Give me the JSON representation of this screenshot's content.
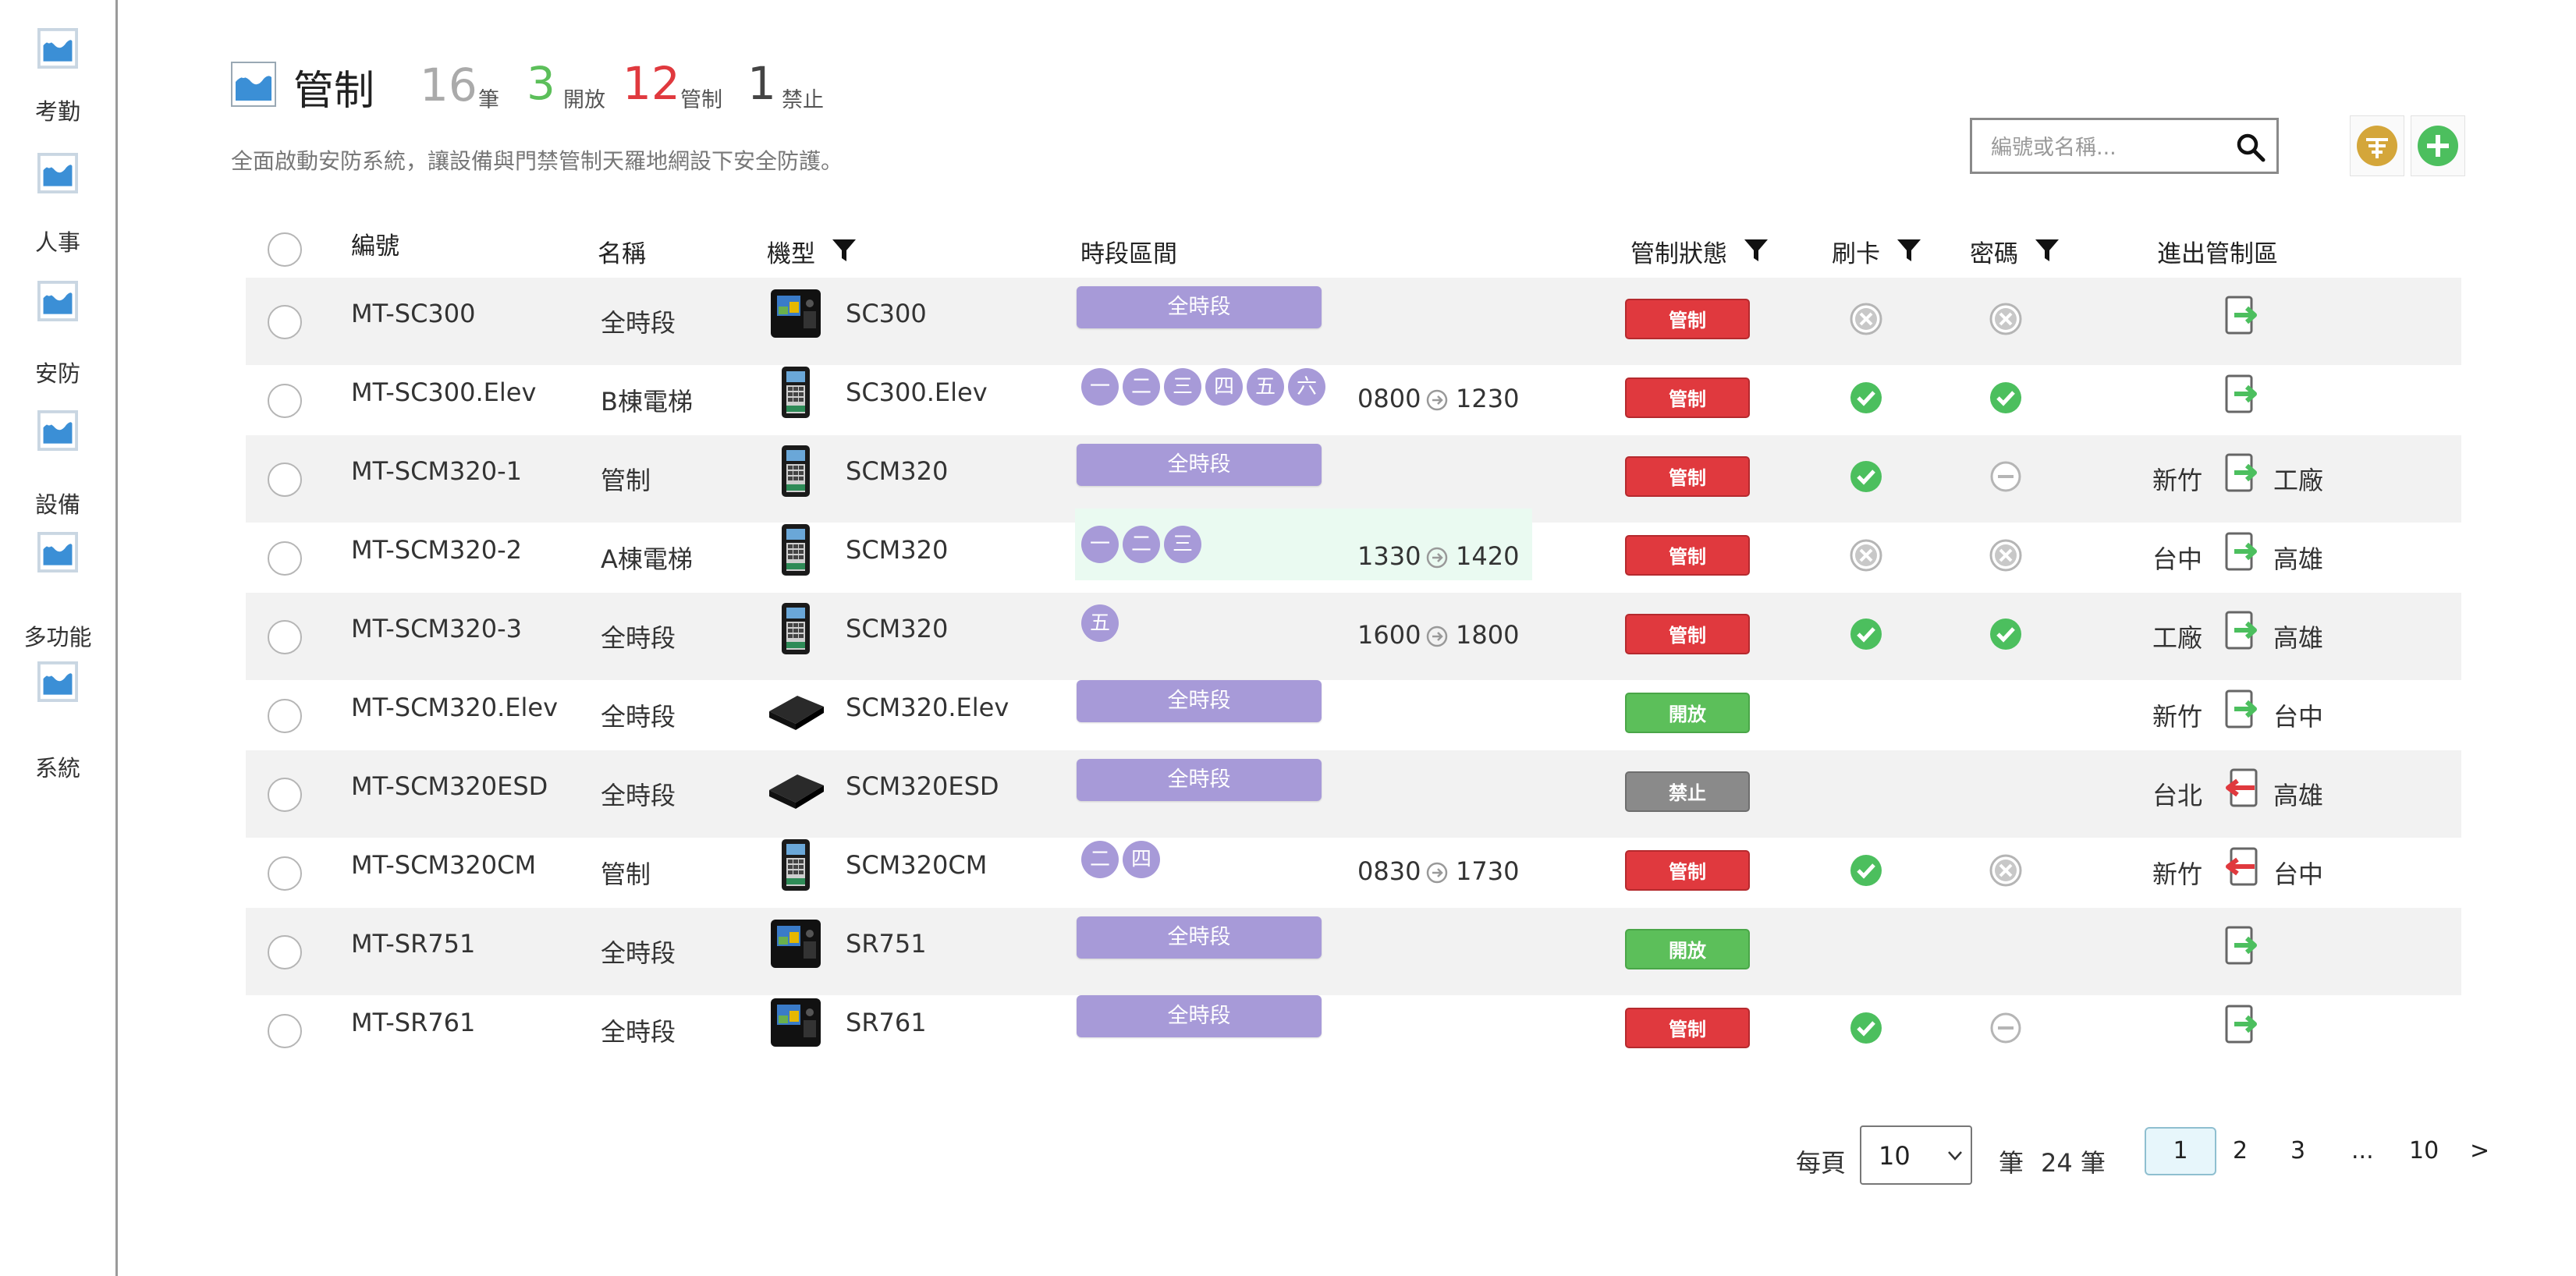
{
  "sidebar": {
    "items": [
      {
        "label": "考勤"
      },
      {
        "label": "人事"
      },
      {
        "label": "安防"
      },
      {
        "label": "設備"
      },
      {
        "label": "多功能"
      },
      {
        "label": "系統"
      }
    ]
  },
  "header": {
    "title": "管制",
    "stats": [
      {
        "value": "16",
        "label": "筆",
        "color": "#aaaaaa"
      },
      {
        "value": "3",
        "label": "開放",
        "color": "#5cbf5a"
      },
      {
        "value": "12",
        "label": "管制",
        "color": "#e0393e"
      },
      {
        "value": "1",
        "label": "禁止",
        "color": "#444444"
      }
    ],
    "subtitle": "全面啟動安防系統，讓設備與門禁管制天羅地網設下安全防護。"
  },
  "search": {
    "placeholder": "編號或名稱..."
  },
  "toolbar": {
    "filter_icon": "filter-circle-icon",
    "add_icon": "plus-circle-icon"
  },
  "table": {
    "columns": {
      "id": "編號",
      "name": "名稱",
      "model": "機型",
      "timeslot": "時段區間",
      "status": "管制狀態",
      "card": "刷卡",
      "password": "密碼",
      "zone": "進出管制區"
    },
    "rows": [
      {
        "id": "MT-SC300",
        "name": "全時段",
        "model": "SC300",
        "device": "terminal",
        "slot": "全時段",
        "days": [],
        "time_from": "",
        "time_to": "",
        "status": "管制",
        "status_color": "red",
        "card": "x",
        "password": "x",
        "zone_from": "",
        "zone_to": "",
        "door": "in"
      },
      {
        "id": "MT-SC300.Elev",
        "name": "B棟電梯",
        "model": "SC300.Elev",
        "device": "keypad",
        "slot": "",
        "days": [
          "一",
          "二",
          "三",
          "四",
          "五",
          "六"
        ],
        "time_from": "0800",
        "time_to": "1230",
        "status": "管制",
        "status_color": "red",
        "card": "check",
        "password": "check",
        "zone_from": "",
        "zone_to": "",
        "door": "in"
      },
      {
        "id": "MT-SCM320-1",
        "name": "管制",
        "model": "SCM320",
        "device": "keypad",
        "slot": "全時段",
        "days": [],
        "time_from": "",
        "time_to": "",
        "status": "管制",
        "status_color": "red",
        "card": "check",
        "password": "none",
        "zone_from": "新竹",
        "zone_to": "工廠",
        "door": "in"
      },
      {
        "id": "MT-SCM320-2",
        "name": "A棟電梯",
        "model": "SCM320",
        "device": "keypad",
        "slot": "",
        "days": [
          "一",
          "二",
          "三"
        ],
        "time_from": "1330",
        "time_to": "1420",
        "status": "管制",
        "status_color": "red",
        "card": "x",
        "password": "x",
        "zone_from": "台中",
        "zone_to": "高雄",
        "door": "in"
      },
      {
        "id": "MT-SCM320-3",
        "name": "全時段",
        "model": "SCM320",
        "device": "keypad",
        "slot": "",
        "days": [
          "五"
        ],
        "time_from": "1600",
        "time_to": "1800",
        "status": "管制",
        "status_color": "red",
        "card": "check",
        "password": "check",
        "zone_from": "工廠",
        "zone_to": "高雄",
        "door": "in"
      },
      {
        "id": "MT-SCM320.Elev",
        "name": "全時段",
        "model": "SCM320.Elev",
        "device": "box",
        "slot": "全時段",
        "days": [],
        "time_from": "",
        "time_to": "",
        "status": "開放",
        "status_color": "green",
        "card": "",
        "password": "",
        "zone_from": "新竹",
        "zone_to": "台中",
        "door": "in"
      },
      {
        "id": "MT-SCM320ESD",
        "name": "全時段",
        "model": "SCM320ESD",
        "device": "box",
        "slot": "全時段",
        "days": [],
        "time_from": "",
        "time_to": "",
        "status": "禁止",
        "status_color": "gray",
        "card": "",
        "password": "",
        "zone_from": "台北",
        "zone_to": "高雄",
        "door": "out"
      },
      {
        "id": "MT-SCM320CM",
        "name": "管制",
        "model": "SCM320CM",
        "device": "keypad",
        "slot": "",
        "days": [
          "二",
          "四"
        ],
        "time_from": "0830",
        "time_to": "1730",
        "status": "管制",
        "status_color": "red",
        "card": "check",
        "password": "x",
        "zone_from": "新竹",
        "zone_to": "台中",
        "door": "out"
      },
      {
        "id": "MT-SR751",
        "name": "全時段",
        "model": "SR751",
        "device": "terminal",
        "slot": "全時段",
        "days": [],
        "time_from": "",
        "time_to": "",
        "status": "開放",
        "status_color": "green",
        "card": "",
        "password": "",
        "zone_from": "",
        "zone_to": "",
        "door": "in"
      },
      {
        "id": "MT-SR761",
        "name": "全時段",
        "model": "SR761",
        "device": "terminal",
        "slot": "全時段",
        "days": [],
        "time_from": "",
        "time_to": "",
        "status": "管制",
        "status_color": "red",
        "card": "check",
        "password": "none",
        "zone_from": "",
        "zone_to": "",
        "door": "in"
      }
    ]
  },
  "pagination": {
    "per_page_label": "每頁",
    "per_page_value": "10",
    "unit_label": "筆",
    "total_label": "24 筆",
    "pages": [
      "1",
      "2",
      "3",
      "...",
      "10"
    ],
    "next": ">"
  },
  "colors": {
    "accent_purple": "#a79ad8",
    "status_red": "#e0393e",
    "status_green": "#5cbf5a",
    "status_gray": "#8a8a8a"
  }
}
